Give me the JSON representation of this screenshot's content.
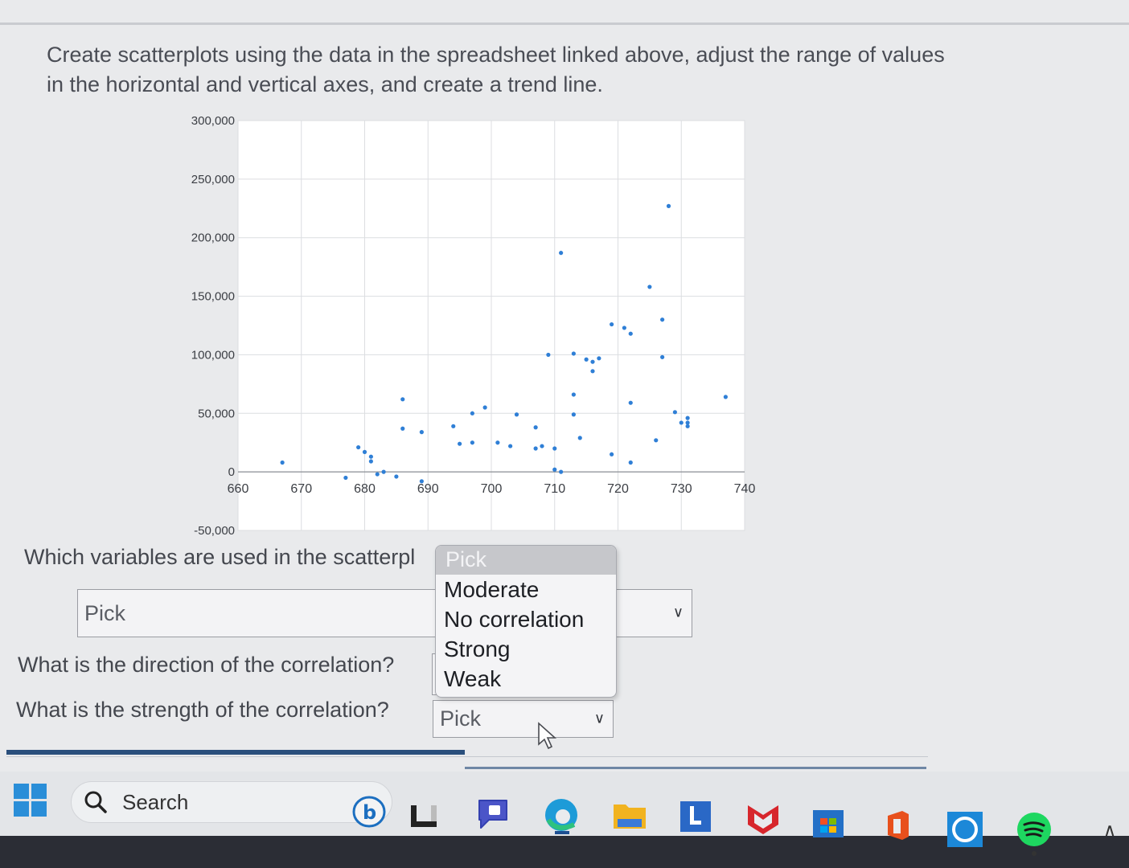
{
  "prompt_text": "Create scatterplots using the data in the spreadsheet linked above, adjust the range of values in the horizontal and vertical axes, and create a trend line.",
  "chart_data": {
    "type": "scatter",
    "xlim": [
      660,
      740
    ],
    "ylim": [
      -50000,
      300000
    ],
    "x_ticks": [
      "660",
      "670",
      "680",
      "690",
      "700",
      "710",
      "720",
      "730",
      "740"
    ],
    "y_ticks": [
      "300,000",
      "250,000",
      "200,000",
      "150,000",
      "100,000",
      "50,000",
      "0",
      "-50,000"
    ],
    "grid": true,
    "point_color": "#2f7fd6",
    "points": [
      [
        667,
        8000
      ],
      [
        677,
        -5000
      ],
      [
        679,
        21000
      ],
      [
        680,
        17000
      ],
      [
        681,
        13000
      ],
      [
        681,
        9000
      ],
      [
        682,
        -2000
      ],
      [
        683,
        0
      ],
      [
        685,
        -4000
      ],
      [
        686,
        37000
      ],
      [
        686,
        62000
      ],
      [
        689,
        -8000
      ],
      [
        689,
        34000
      ],
      [
        694,
        39000
      ],
      [
        695,
        24000
      ],
      [
        697,
        50000
      ],
      [
        697,
        25000
      ],
      [
        699,
        55000
      ],
      [
        701,
        25000
      ],
      [
        703,
        22000
      ],
      [
        704,
        49000
      ],
      [
        707,
        38000
      ],
      [
        707,
        20000
      ],
      [
        708,
        22000
      ],
      [
        709,
        100000
      ],
      [
        711,
        187000
      ],
      [
        710,
        20000
      ],
      [
        710,
        2000
      ],
      [
        711,
        0
      ],
      [
        713,
        101000
      ],
      [
        713,
        66000
      ],
      [
        713,
        49000
      ],
      [
        714,
        29000
      ],
      [
        715,
        96000
      ],
      [
        716,
        94000
      ],
      [
        716,
        86000
      ],
      [
        717,
        97000
      ],
      [
        719,
        126000
      ],
      [
        719,
        15000
      ],
      [
        721,
        123000
      ],
      [
        722,
        118000
      ],
      [
        722,
        8000
      ],
      [
        722,
        59000
      ],
      [
        725,
        158000
      ],
      [
        726,
        27000
      ],
      [
        727,
        130000
      ],
      [
        727,
        98000
      ],
      [
        728,
        227000
      ],
      [
        729,
        51000
      ],
      [
        730,
        42000
      ],
      [
        731,
        46000
      ],
      [
        731,
        39000
      ],
      [
        731,
        42000
      ],
      [
        737,
        64000
      ]
    ]
  },
  "questions": {
    "q1": "Which variables are used in the scatterpl",
    "q1_select": "Pick",
    "q2": "What is the direction of the correlation?",
    "q3": "What is the strength of the correlation?",
    "q3_select": "Pick"
  },
  "dropdown": {
    "header": "Pick",
    "options": [
      "Moderate",
      "No correlation",
      "Strong",
      "Weak"
    ]
  },
  "taskbar": {
    "search_label": "Search",
    "icons": [
      "windows-start-icon",
      "bing-icon",
      "terminal-icon",
      "chat-icon",
      "edge-icon",
      "file-explorer-icon",
      "lenovo-icon",
      "mcafee-icon",
      "store-icon",
      "office-icon",
      "alexa-icon",
      "spotify-icon"
    ]
  }
}
